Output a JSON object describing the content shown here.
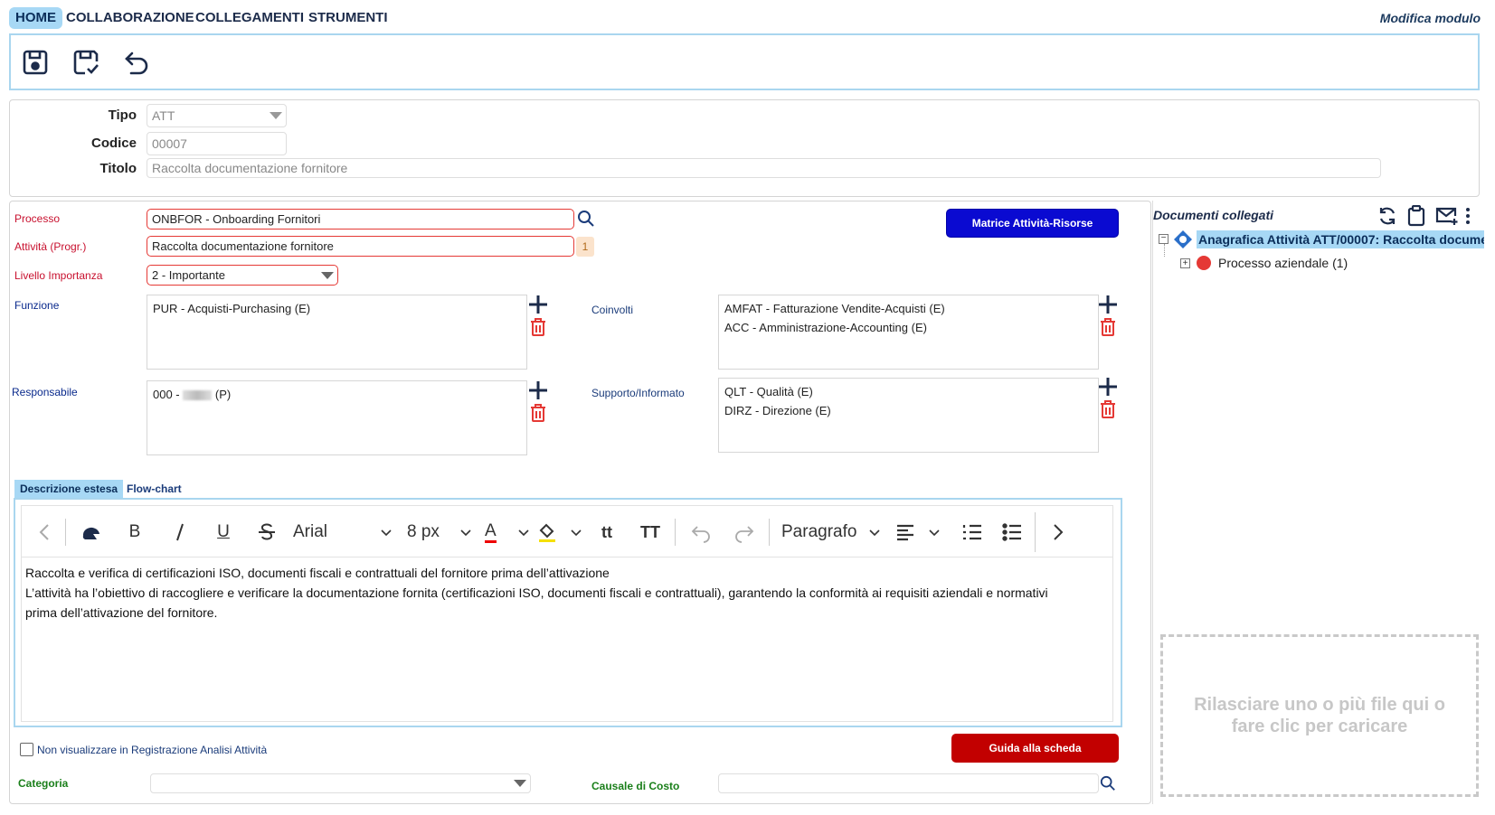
{
  "menu": {
    "items": [
      "HOME",
      "COLLABORAZIONE",
      "COLLEGAMENTI",
      "STRUMENTI"
    ],
    "module_title": "Modifica modulo"
  },
  "toolbar": {
    "icons": [
      "save-icon",
      "save-and-close-icon",
      "undo-icon"
    ]
  },
  "header": {
    "tipo_label": "Tipo",
    "tipo_value": "ATT",
    "codice_label": "Codice",
    "codice_value": "00007",
    "titolo_label": "Titolo",
    "titolo_value": "Raccolta documentazione fornitore"
  },
  "form": {
    "processo_label": "Processo",
    "processo_value": "ONBFOR - Onboarding Fornitori",
    "attivita_label": "Attività (Progr.)",
    "attivita_value": "Raccolta documentazione fornitore",
    "attivita_progr": "1",
    "livello_label": "Livello Importanza",
    "livello_value": "2 - Importante",
    "matrice_button": "Matrice Attività-Risorse",
    "funzione_label": "Funzione",
    "funzione_items": [
      "PUR - Acquisti-Purchasing (E)"
    ],
    "coinvolti_label": "Coinvolti",
    "coinvolti_items": [
      "AMFAT - Fatturazione Vendite-Acquisti (E)",
      "ACC - Amministrazione-Accounting (E)"
    ],
    "responsabile_label": "Responsabile",
    "responsabile_prefix": "000 -",
    "responsabile_suffix": "(P)",
    "supporto_label": "Supporto/Informato",
    "supporto_items": [
      "QLT - Qualità (E)",
      "DIRZ - Direzione (E)"
    ]
  },
  "tabs": [
    "Descrizione estesa",
    "Flow-chart"
  ],
  "editor": {
    "font": "Arial",
    "size": "8 px",
    "paragraph": "Paragrafo",
    "line1": "Raccolta e verifica di certificazioni ISO, documenti fiscali e contrattuali del fornitore prima dell’attivazione",
    "line2": "L’attività ha l’obiettivo di raccogliere e verificare la documentazione fornita (certificazioni ISO, documenti fiscali e contrattuali), garantendo la conformità ai requisiti aziendali e normativi",
    "line3": "prima dell’attivazione del fornitore."
  },
  "footer": {
    "checkbox_label": "Non visualizzare in Registrazione Analisi Attività",
    "guida_button": "Guida alla scheda",
    "categoria_label": "Categoria",
    "causale_label": "Causale di Costo"
  },
  "docs": {
    "title": "Documenti collegati",
    "root_node": "Anagrafica Attività ATT/00007: Raccolta docume",
    "child_node": "Processo aziendale (1)",
    "dropzone_text": "Rilasciare uno o più file qui o fare clic per caricare"
  },
  "colors": {
    "accent_blue": "#0a0ad1",
    "accent_red": "#c20000",
    "tab_active": "#a7d8f5",
    "node_red": "#e53935"
  }
}
